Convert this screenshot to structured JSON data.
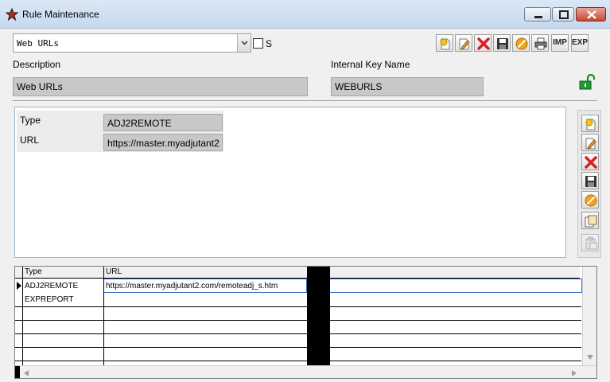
{
  "window": {
    "title": "Rule Maintenance",
    "accent": "#c6d9ef"
  },
  "selector": {
    "value": "Web URLs",
    "checkbox_label": "S",
    "checkbox_checked": false
  },
  "toolbar": {
    "icons": [
      "new-icon",
      "edit-icon",
      "delete-icon",
      "save-icon",
      "cancel-icon",
      "print-icon"
    ],
    "imp_label": "IMP",
    "exp_label": "EXP"
  },
  "form": {
    "description_label": "Description",
    "description_value": "Web URLs",
    "internal_key_label": "Internal Key Name",
    "internal_key_value": "WEBURLS"
  },
  "detail": {
    "type_label": "Type",
    "type_value": "ADJ2REMOTE",
    "url_label": "URL",
    "url_value": "https://master.myadjutant2"
  },
  "side_toolbar": {
    "icons": [
      "new-icon",
      "edit-icon",
      "delete-icon",
      "save-icon",
      "cancel-icon",
      "copy-icon",
      "paste-icon"
    ]
  },
  "grid": {
    "columns": [
      "Type",
      "URL"
    ],
    "rows": [
      {
        "type": "ADJ2REMOTE",
        "url": "https://master.myadjutant2.com/remoteadj_s.htm",
        "selected": true
      },
      {
        "type": "EXPREPORT",
        "url": ""
      }
    ]
  }
}
